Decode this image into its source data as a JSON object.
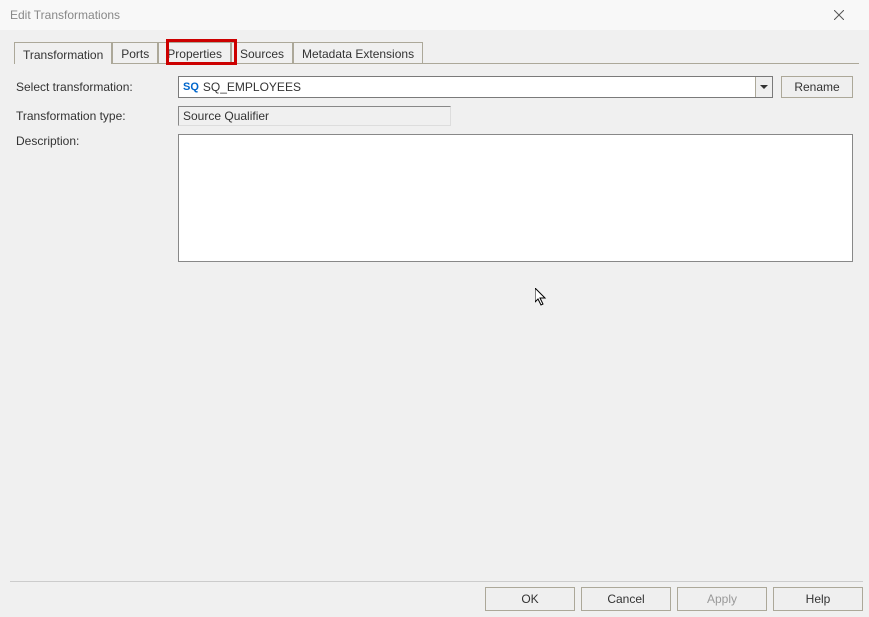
{
  "window": {
    "title": "Edit Transformations"
  },
  "tabs": {
    "items": [
      {
        "label": "Transformation"
      },
      {
        "label": "Ports"
      },
      {
        "label": "Properties"
      },
      {
        "label": "Sources"
      },
      {
        "label": "Metadata Extensions"
      }
    ]
  },
  "form": {
    "select_label": "Select transformation:",
    "select_icon": "SQ",
    "select_value": "SQ_EMPLOYEES",
    "rename_label": "Rename",
    "type_label": "Transformation type:",
    "type_value": "Source Qualifier",
    "description_label": "Description:",
    "description_value": ""
  },
  "buttons": {
    "ok": "OK",
    "cancel": "Cancel",
    "apply": "Apply",
    "help": "Help"
  }
}
